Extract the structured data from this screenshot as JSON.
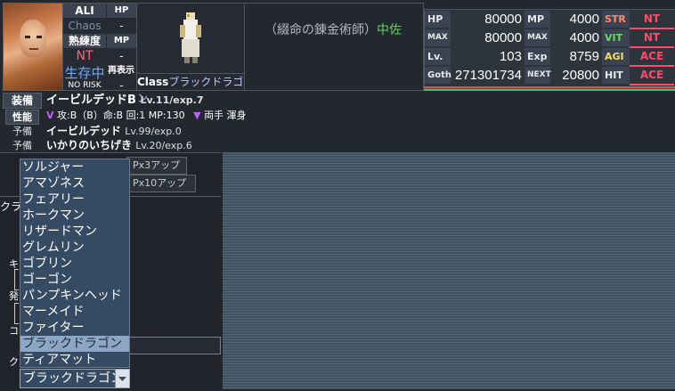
{
  "unit": {
    "alignment_label": "ALI",
    "alignment_value": "Chaos",
    "proficiency_label": "熟練度",
    "proficiency_value": "NT",
    "status_value": "生存中",
    "risk_value": "NO RISK",
    "hp_label": "HP",
    "hp_value": "-",
    "mp_label": "MP",
    "mp_value": "-",
    "redisplay_label": "再表示",
    "redisplay_value": "-",
    "title_prefix": "（綴命の錬金術師）",
    "title_rank": "中佐",
    "class_label": "Class",
    "class_value": "ブラックドラゴン"
  },
  "stats": {
    "hp": {
      "label": "HP",
      "value": "80000"
    },
    "mp": {
      "label": "MP",
      "value": "4000"
    },
    "max_hp": {
      "label": "MAX",
      "value": "80000"
    },
    "max_mp": {
      "label": "MAX",
      "value": "4000"
    },
    "lv": {
      "label": "Lv.",
      "value": "103"
    },
    "exp": {
      "label": "Exp",
      "value": "8759"
    },
    "goth": {
      "label": "Goth",
      "value": "271301734"
    },
    "next": {
      "label": "NEXT",
      "value": "20800"
    },
    "str": {
      "label": "STR",
      "value": "NT"
    },
    "vit": {
      "label": "VIT",
      "value": "NT"
    },
    "agi": {
      "label": "AGI",
      "value": "ACE"
    },
    "hit": {
      "label": "HIT",
      "value": "ACE"
    }
  },
  "equip": {
    "label": "装備",
    "name": "イービルデッドB",
    "level": "Lv.11/exp.7",
    "perf_label": "性能",
    "perf_text": "攻:B（B）命:B 回:1 MP:130",
    "perf_extra": "両手 渾身",
    "reserve_label": "予備",
    "reserve1_name": "イービルデッド",
    "reserve1_level": "Lv.99/exp.0",
    "reserve2_name": "いかりのいちげき",
    "reserve2_level": "Lv.20/exp.6"
  },
  "panel": {
    "btn1": "Px3アップ",
    "btn2": "Px10アップ",
    "frag1": "クラ",
    "frag2": "キ",
    "frag3": "発",
    "frag4": "コ",
    "frag5": "ク"
  },
  "dropdown": {
    "items": [
      "ソルジャー",
      "アマゾネス",
      "フェアリー",
      "ホークマン",
      "リザードマン",
      "グレムリン",
      "ゴブリン",
      "ゴーゴン",
      "パンプキンヘッド",
      "マーメイド",
      "ファイター",
      "ブラックドラゴン",
      "ティアマット"
    ],
    "selected_index": 11,
    "current_value": "ブラックドラゴン"
  },
  "colors": {
    "rank": "#5fd35f",
    "pill": "#ff4a6a",
    "selected": "#8ea6c6",
    "perf_mark": "#c05cff"
  }
}
